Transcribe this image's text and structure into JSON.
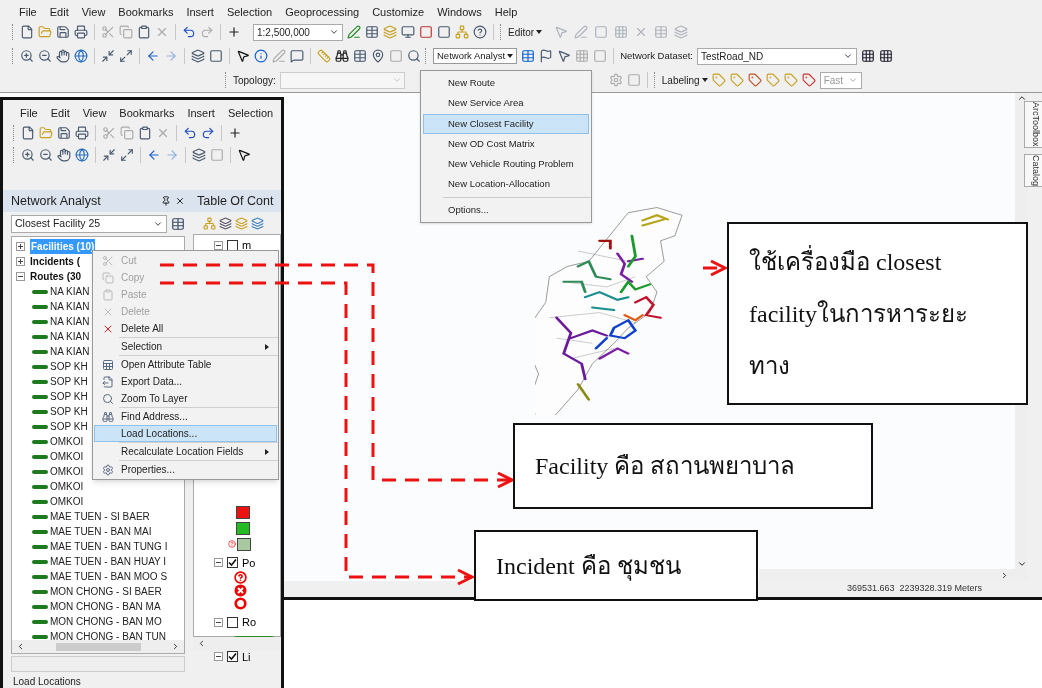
{
  "main_window": {
    "menu": [
      "File",
      "Edit",
      "View",
      "Bookmarks",
      "Insert",
      "Selection",
      "Geoprocessing",
      "Customize",
      "Windows",
      "Help"
    ],
    "scale": "1:2,500,000",
    "editor_menu": "Editor",
    "topology_label": "Topology:",
    "network_analyst_menu": "Network Analyst",
    "network_dataset_label": "Network Dataset:",
    "network_dataset": "TestRoad_ND",
    "labeling_menu": "Labeling",
    "label_quality": "Fast",
    "network_analyst_dropdown": [
      {
        "kind": "item",
        "label": "New Route",
        "selected": false
      },
      {
        "kind": "item",
        "label": "New Service Area",
        "selected": false
      },
      {
        "kind": "item",
        "label": "New Closest Facility",
        "selected": true
      },
      {
        "kind": "item",
        "label": "New OD Cost Matrix",
        "selected": false
      },
      {
        "kind": "item",
        "label": "New Vehicle Routing Problem",
        "selected": false
      },
      {
        "kind": "item",
        "label": "New Location-Allocation",
        "selected": false
      },
      {
        "kind": "separator"
      },
      {
        "kind": "item",
        "label": "Options...",
        "selected": false
      }
    ],
    "side_tabs": [
      "ArcToolbox",
      "Catalog"
    ],
    "status_coordinates": "369531.663  2239328.319 Meters"
  },
  "inset_window": {
    "menu": [
      "File",
      "Edit",
      "View",
      "Bookmarks",
      "Insert",
      "Selection"
    ],
    "network_analyst": {
      "title": "Network Analyst",
      "analysis": "Closest Facility 25",
      "classes": [
        {
          "label": "Facilities (10)",
          "expanded": false,
          "selected": true
        },
        {
          "label": "Incidents (",
          "expanded": false,
          "selected": false
        },
        {
          "label": "Routes (30",
          "expanded": true,
          "selected": false,
          "children": [
            {
              "label": "NA KIAN",
              "selected": false
            },
            {
              "label": "NA KIAN",
              "selected": false
            },
            {
              "label": "NA KIAN",
              "selected": false
            },
            {
              "label": "NA KIAN",
              "selected": false
            },
            {
              "label": "NA KIAN",
              "selected": false
            },
            {
              "label": "SOP KH",
              "selected": false
            },
            {
              "label": "SOP KH",
              "selected": false
            },
            {
              "label": "SOP KH",
              "selected": false
            },
            {
              "label": "SOP KH",
              "selected": false
            },
            {
              "label": "SOP KH",
              "selected": false
            },
            {
              "label": "OMKOI",
              "selected": false
            },
            {
              "label": "OMKOI",
              "selected": false
            },
            {
              "label": "OMKOI",
              "selected": false
            },
            {
              "label": "OMKOI",
              "selected": false
            },
            {
              "label": "OMKOI",
              "selected": false
            },
            {
              "label": "MAE TUEN - SI BAER",
              "selected": false
            },
            {
              "label": "MAE TUEN - BAN MAI",
              "selected": false
            },
            {
              "label": "MAE TUEN - BAN TUNG I",
              "selected": false
            },
            {
              "label": "MAE TUEN - BAN HUAY I",
              "selected": false
            },
            {
              "label": "MAE TUEN - BAN MOO S",
              "selected": false
            },
            {
              "label": "MON CHONG - SI BAER",
              "selected": false
            },
            {
              "label": "MON CHONG - BAN MA",
              "selected": false
            },
            {
              "label": "MON CHONG - BAN MO",
              "selected": false
            },
            {
              "label": "MON CHONG - BAN TUN",
              "selected": false
            }
          ]
        }
      ]
    },
    "toc": {
      "title": "Table Of Cont",
      "layers": [
        {
          "label": "m",
          "checked": false,
          "kind": "fills"
        },
        {
          "label": "Po",
          "checked": true,
          "kind": "points"
        },
        {
          "label": "Ro",
          "checked": false,
          "kind": "line"
        },
        {
          "label": "Li",
          "checked": true,
          "kind": "none"
        }
      ]
    },
    "context_menu": [
      {
        "kind": "item",
        "label": "Cut",
        "disabled": true,
        "selected": false,
        "submenu": false
      },
      {
        "kind": "item",
        "label": "Copy",
        "disabled": true,
        "selected": false,
        "submenu": false
      },
      {
        "kind": "item",
        "label": "Paste",
        "disabled": true,
        "selected": false,
        "submenu": false
      },
      {
        "kind": "item",
        "label": "Delete",
        "disabled": true,
        "selected": false,
        "submenu": false
      },
      {
        "kind": "item",
        "label": "Delete All",
        "disabled": false,
        "selected": false,
        "submenu": false
      },
      {
        "kind": "separator"
      },
      {
        "kind": "item",
        "label": "Selection",
        "disabled": false,
        "selected": false,
        "submenu": true
      },
      {
        "kind": "separator"
      },
      {
        "kind": "item",
        "label": "Open Attribute Table",
        "disabled": false,
        "selected": false,
        "submenu": false
      },
      {
        "kind": "item",
        "label": "Export Data...",
        "disabled": false,
        "selected": false,
        "submenu": false
      },
      {
        "kind": "item",
        "label": "Zoom To Layer",
        "disabled": false,
        "selected": false,
        "submenu": false
      },
      {
        "kind": "separator"
      },
      {
        "kind": "item",
        "label": "Find Address...",
        "disabled": false,
        "selected": false,
        "submenu": false
      },
      {
        "kind": "item",
        "label": "Load Locations...",
        "disabled": false,
        "selected": true,
        "submenu": false
      },
      {
        "kind": "separator"
      },
      {
        "kind": "item",
        "label": "Recalculate Location Fields",
        "disabled": false,
        "selected": false,
        "submenu": true
      },
      {
        "kind": "separator"
      },
      {
        "kind": "item",
        "label": "Properties...",
        "disabled": false,
        "selected": false,
        "submenu": false
      }
    ],
    "status": "Load Locations"
  },
  "callouts": [
    {
      "text": "ใช้เครื่องมือ closest facilityในการหาระยะทาง"
    },
    {
      "text": "Facility คือ สถานพยาบาล"
    },
    {
      "text": "Incident คือ ชุมชน"
    }
  ]
}
